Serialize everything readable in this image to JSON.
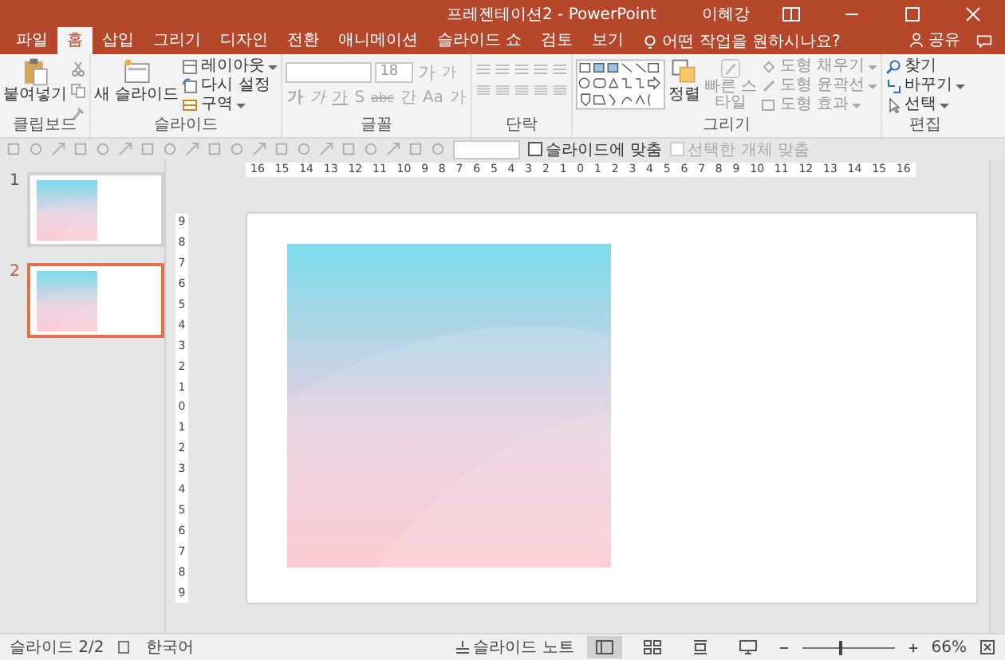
{
  "window": {
    "title": "프레젠테이션2 - PowerPoint",
    "user": "이혜강"
  },
  "tabs": [
    {
      "label": "파일",
      "selected": false
    },
    {
      "label": "홈",
      "selected": true
    },
    {
      "label": "삽입",
      "selected": false
    },
    {
      "label": "그리기",
      "selected": false
    },
    {
      "label": "디자인",
      "selected": false
    },
    {
      "label": "전환",
      "selected": false
    },
    {
      "label": "애니메이션",
      "selected": false
    },
    {
      "label": "슬라이드 쇼",
      "selected": false
    },
    {
      "label": "검토",
      "selected": false
    },
    {
      "label": "보기",
      "selected": false
    }
  ],
  "tell_me": {
    "placeholder": "어떤 작업을 원하시나요?"
  },
  "share": "공유",
  "clipboard": {
    "label": "클립보드",
    "paste": "붙여넣기"
  },
  "slides_group": {
    "label": "슬라이드",
    "new_slide": "새 슬라이드",
    "layout": "레이아웃",
    "reset": "다시 설정",
    "section": "구역"
  },
  "font_group": {
    "label": "글꼴",
    "font_size": "18",
    "size_buttons": [
      "가",
      "가"
    ],
    "format_buttons": [
      "가",
      "가",
      "가",
      "S",
      "abc",
      "간",
      "Aa",
      "가"
    ]
  },
  "paragraph_group": {
    "label": "단락"
  },
  "drawing_group": {
    "label": "그리기",
    "arrange": "정렬",
    "quick_styles": "빠른 스타일",
    "fill": "도형 채우기",
    "outline": "도형 윤곽선",
    "effects": "도형 효과"
  },
  "editing_group": {
    "label": "편집",
    "find": "찾기",
    "replace": "바꾸기",
    "select": "선택"
  },
  "fit_slide": {
    "label": "슬라이드에 맞춤",
    "checked": false
  },
  "fit_selection": {
    "label": "선택한 개체 맞춤",
    "disabled": true
  },
  "ruler": {
    "horizontal": [
      "16",
      "15",
      "14",
      "13",
      "12",
      "11",
      "10",
      "9",
      "8",
      "7",
      "6",
      "5",
      "4",
      "3",
      "2",
      "1",
      "0",
      "1",
      "2",
      "3",
      "4",
      "5",
      "6",
      "7",
      "8",
      "9",
      "10",
      "11",
      "12",
      "13",
      "14",
      "15",
      "16"
    ],
    "vertical": [
      "9",
      "8",
      "7",
      "6",
      "5",
      "4",
      "3",
      "2",
      "1",
      "0",
      "1",
      "2",
      "3",
      "4",
      "5",
      "6",
      "7",
      "8",
      "9"
    ]
  },
  "slides": [
    {
      "number": "1",
      "selected": false
    },
    {
      "number": "2",
      "selected": true
    }
  ],
  "status_bar": {
    "slide": "슬라이드 2/2",
    "language": "한국어",
    "notes": "슬라이드 노트",
    "views": [
      {
        "kind": "normal",
        "selected": true
      },
      {
        "kind": "sorter",
        "selected": false
      },
      {
        "kind": "reading",
        "selected": false
      },
      {
        "kind": "slideshow",
        "selected": false
      }
    ],
    "zoom": {
      "level": 0.4
    },
    "zoom_text": "66%"
  }
}
